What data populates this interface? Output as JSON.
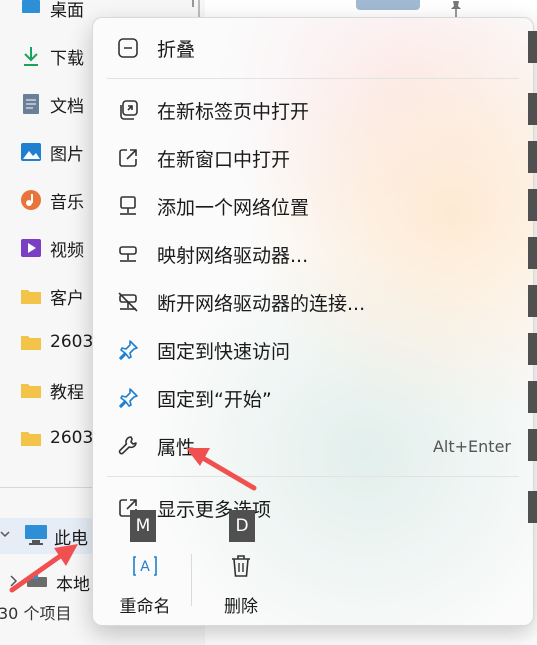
{
  "nav": {
    "items": [
      {
        "label": "桌面",
        "icon": "desktop-icon"
      },
      {
        "label": "下载",
        "icon": "download-icon"
      },
      {
        "label": "文档",
        "icon": "document-icon"
      },
      {
        "label": "图片",
        "icon": "pictures-icon"
      },
      {
        "label": "音乐",
        "icon": "music-icon"
      },
      {
        "label": "视频",
        "icon": "video-icon"
      },
      {
        "label": "客户",
        "icon": "folder-icon"
      },
      {
        "label": "2603",
        "icon": "folder-icon"
      },
      {
        "label": "教程",
        "icon": "folder-icon"
      },
      {
        "label": "2603",
        "icon": "folder-icon"
      }
    ],
    "this_pc": "此电",
    "local_disk": "本地"
  },
  "status": {
    "item_count": "30 个项目"
  },
  "menu": {
    "items": [
      {
        "label": "折叠",
        "icon": "collapse-icon",
        "shortcut": ""
      },
      {
        "label": "在新标签页中打开",
        "icon": "new-tab-icon",
        "shortcut": ""
      },
      {
        "label": "在新窗口中打开",
        "icon": "new-window-icon",
        "shortcut": ""
      },
      {
        "label": "添加一个网络位置",
        "icon": "network-location-icon",
        "shortcut": ""
      },
      {
        "label": "映射网络驱动器...",
        "icon": "map-drive-icon",
        "shortcut": ""
      },
      {
        "label": "断开网络驱动器的连接...",
        "icon": "disconnect-drive-icon",
        "shortcut": ""
      },
      {
        "label": "固定到快速访问",
        "icon": "pin-icon",
        "shortcut": ""
      },
      {
        "label": "固定到“开始”",
        "icon": "pin-icon",
        "shortcut": ""
      },
      {
        "label": "属性",
        "icon": "wrench-icon",
        "shortcut": "Alt+Enter"
      },
      {
        "label": "显示更多选项",
        "icon": "more-options-icon",
        "shortcut": ""
      }
    ],
    "bottom": {
      "rename_label": "重命名",
      "delete_label": "删除",
      "rename_key": "M",
      "delete_key": "D"
    }
  },
  "colors": {
    "accent": "#0f6cbd",
    "annotation_arrow": "#f05050",
    "keytip_bg": "#505050"
  }
}
